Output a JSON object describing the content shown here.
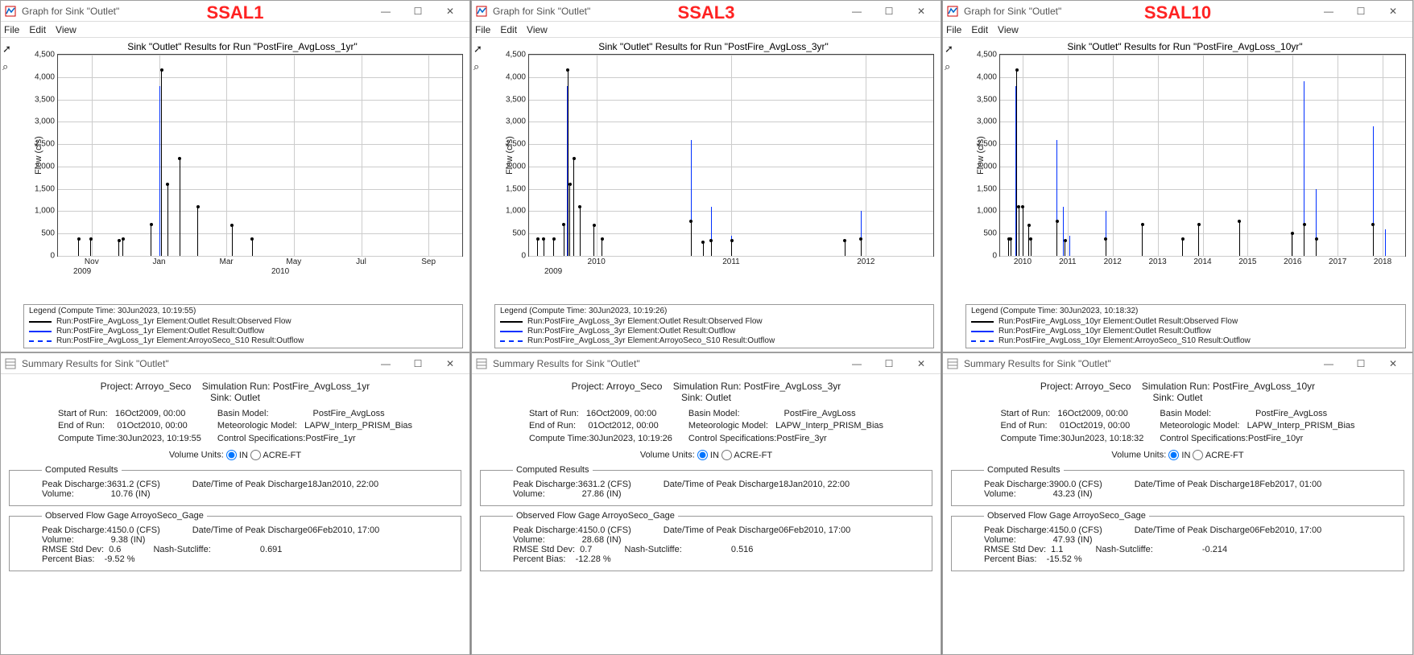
{
  "panels": [
    {
      "id": "ssal1",
      "overlay": "SSAL1",
      "graph_window_title": "Graph for Sink \"Outlet\"",
      "summary_window_title": "Summary Results for Sink \"Outlet\"",
      "menu": {
        "file": "File",
        "edit": "Edit",
        "view": "View"
      },
      "chart_title": "Sink \"Outlet\" Results for Run \"PostFire_AvgLoss_1yr\"",
      "legend_title": "Legend (Compute Time: 30Jun2023, 10:19:55)",
      "legend_items": [
        "Run:PostFire_AvgLoss_1yr Element:Outlet Result:Observed Flow",
        "Run:PostFire_AvgLoss_1yr Element:Outlet Result:Outflow",
        "Run:PostFire_AvgLoss_1yr Element:ArroyoSeco_S10 Result:Outflow"
      ],
      "summary": {
        "project": "Arroyo_Seco",
        "run": "PostFire_AvgLoss_1yr",
        "sink": "Outlet",
        "start": "16Oct2009, 00:00",
        "end": "01Oct2010, 00:00",
        "compute": "30Jun2023, 10:19:55",
        "basin": "PostFire_AvgLoss",
        "met": "LAPW_Interp_PRISM_Bias",
        "ctrl": "PostFire_1yr",
        "computed": {
          "peak_discharge": "3631.2 (CFS)",
          "peak_time": "18Jan2010, 22:00",
          "volume": "10.76 (IN)"
        },
        "observed": {
          "gage": "ArroyoSeco_Gage",
          "peak_discharge": "4150.0 (CFS)",
          "peak_time": "06Feb2010, 17:00",
          "volume": "9.38 (IN)",
          "rmse": "0.6",
          "nash": "0.691",
          "bias": "-9.52 %"
        }
      },
      "chart_data": {
        "type": "line",
        "title": "Sink \"Outlet\" Results for Run \"PostFire_AvgLoss_1yr\"",
        "ylabel": "Flow (cfs)",
        "ylim": [
          0,
          4500
        ],
        "y_ticks": [
          0,
          500,
          1000,
          1500,
          2000,
          2500,
          3000,
          3500,
          4000,
          4500
        ],
        "x_ticks": [
          "Nov",
          "Jan",
          "Mar",
          "May",
          "Jul",
          "Sep"
        ],
        "x_years": [
          "2009",
          "2010"
        ],
        "series": [
          {
            "name": "Observed Flow",
            "color": "#000",
            "peaks": [
              {
                "x": 0.05,
                "y": 380
              },
              {
                "x": 0.08,
                "y": 380
              },
              {
                "x": 0.15,
                "y": 350
              },
              {
                "x": 0.16,
                "y": 380
              },
              {
                "x": 0.23,
                "y": 700
              },
              {
                "x": 0.255,
                "y": 4150
              },
              {
                "x": 0.27,
                "y": 1600
              },
              {
                "x": 0.3,
                "y": 2180
              },
              {
                "x": 0.345,
                "y": 1100
              },
              {
                "x": 0.43,
                "y": 680
              },
              {
                "x": 0.48,
                "y": 380
              }
            ]
          },
          {
            "name": "Outflow",
            "color": "#0030ff",
            "peaks": [
              {
                "x": 0.05,
                "y": 60
              },
              {
                "x": 0.15,
                "y": 80
              },
              {
                "x": 0.23,
                "y": 350
              },
              {
                "x": 0.25,
                "y": 3800
              },
              {
                "x": 0.27,
                "y": 1400
              },
              {
                "x": 0.3,
                "y": 1850
              },
              {
                "x": 0.345,
                "y": 600
              },
              {
                "x": 0.43,
                "y": 280
              },
              {
                "x": 0.48,
                "y": 180
              }
            ]
          }
        ]
      }
    },
    {
      "id": "ssal3",
      "overlay": "SSAL3",
      "graph_window_title": "Graph for Sink \"Outlet\"",
      "summary_window_title": "Summary Results for Sink \"Outlet\"",
      "menu": {
        "file": "File",
        "edit": "Edit",
        "view": "View"
      },
      "chart_title": "Sink \"Outlet\" Results for Run \"PostFire_AvgLoss_3yr\"",
      "legend_title": "Legend (Compute Time: 30Jun2023, 10:19:26)",
      "legend_items": [
        "Run:PostFire_AvgLoss_3yr Element:Outlet Result:Observed Flow",
        "Run:PostFire_AvgLoss_3yr Element:Outlet Result:Outflow",
        "Run:PostFire_AvgLoss_3yr Element:ArroyoSeco_S10 Result:Outflow"
      ],
      "summary": {
        "project": "Arroyo_Seco",
        "run": "PostFire_AvgLoss_3yr",
        "sink": "Outlet",
        "start": "16Oct2009, 00:00",
        "end": "01Oct2012, 00:00",
        "compute": "30Jun2023, 10:19:26",
        "basin": "PostFire_AvgLoss",
        "met": "LAPW_Interp_PRISM_Bias",
        "ctrl": "PostFire_3yr",
        "computed": {
          "peak_discharge": "3631.2 (CFS)",
          "peak_time": "18Jan2010, 22:00",
          "volume": "27.86 (IN)"
        },
        "observed": {
          "gage": "ArroyoSeco_Gage",
          "peak_discharge": "4150.0 (CFS)",
          "peak_time": "06Feb2010, 17:00",
          "volume": "28.68 (IN)",
          "rmse": "0.7",
          "nash": "0.516",
          "bias": "-12.28 %"
        }
      },
      "chart_data": {
        "type": "line",
        "title": "Sink \"Outlet\" Results for Run \"PostFire_AvgLoss_3yr\"",
        "ylabel": "Flow (cfs)",
        "ylim": [
          0,
          4500
        ],
        "y_ticks": [
          0,
          500,
          1000,
          1500,
          2000,
          2500,
          3000,
          3500,
          4000,
          4500
        ],
        "x_ticks": [
          "2010",
          "2011",
          "2012"
        ],
        "x_years": [
          "2009"
        ],
        "series": [
          {
            "name": "Observed Flow",
            "color": "#000",
            "peaks": [
              {
                "x": 0.02,
                "y": 380
              },
              {
                "x": 0.035,
                "y": 380
              },
              {
                "x": 0.06,
                "y": 380
              },
              {
                "x": 0.085,
                "y": 700
              },
              {
                "x": 0.095,
                "y": 4150
              },
              {
                "x": 0.1,
                "y": 1600
              },
              {
                "x": 0.11,
                "y": 2180
              },
              {
                "x": 0.125,
                "y": 1100
              },
              {
                "x": 0.16,
                "y": 680
              },
              {
                "x": 0.18,
                "y": 380
              },
              {
                "x": 0.4,
                "y": 780
              },
              {
                "x": 0.43,
                "y": 300
              },
              {
                "x": 0.45,
                "y": 350
              },
              {
                "x": 0.5,
                "y": 350
              },
              {
                "x": 0.78,
                "y": 350
              },
              {
                "x": 0.82,
                "y": 380
              }
            ]
          },
          {
            "name": "Outflow",
            "color": "#0030ff",
            "peaks": [
              {
                "x": 0.085,
                "y": 350
              },
              {
                "x": 0.093,
                "y": 3800
              },
              {
                "x": 0.1,
                "y": 1400
              },
              {
                "x": 0.11,
                "y": 1850
              },
              {
                "x": 0.125,
                "y": 600
              },
              {
                "x": 0.16,
                "y": 280
              },
              {
                "x": 0.4,
                "y": 2600
              },
              {
                "x": 0.43,
                "y": 300
              },
              {
                "x": 0.45,
                "y": 1100
              },
              {
                "x": 0.5,
                "y": 450
              },
              {
                "x": 0.78,
                "y": 350
              },
              {
                "x": 0.82,
                "y": 1000
              }
            ]
          }
        ]
      }
    },
    {
      "id": "ssal10",
      "overlay": "SSAL10",
      "graph_window_title": "Graph for Sink \"Outlet\"",
      "summary_window_title": "Summary Results for Sink \"Outlet\"",
      "menu": {
        "file": "File",
        "edit": "Edit",
        "view": "View"
      },
      "chart_title": "Sink \"Outlet\" Results for Run \"PostFire_AvgLoss_10yr\"",
      "legend_title": "Legend (Compute Time: 30Jun2023, 10:18:32)",
      "legend_items": [
        "Run:PostFire_AvgLoss_10yr Element:Outlet Result:Observed Flow",
        "Run:PostFire_AvgLoss_10yr Element:Outlet Result:Outflow",
        "Run:PostFire_AvgLoss_10yr Element:ArroyoSeco_S10 Result:Outflow"
      ],
      "summary": {
        "project": "Arroyo_Seco",
        "run": "PostFire_AvgLoss_10yr",
        "sink": "Outlet",
        "start": "16Oct2009, 00:00",
        "end": "01Oct2019, 00:00",
        "compute": "30Jun2023, 10:18:32",
        "basin": "PostFire_AvgLoss",
        "met": "LAPW_Interp_PRISM_Bias",
        "ctrl": "PostFire_10yr",
        "computed": {
          "peak_discharge": "3900.0 (CFS)",
          "peak_time": "18Feb2017, 01:00",
          "volume": "43.23 (IN)"
        },
        "observed": {
          "gage": "ArroyoSeco_Gage",
          "peak_discharge": "4150.0 (CFS)",
          "peak_time": "06Feb2010, 17:00",
          "volume": "47.93 (IN)",
          "rmse": "1.1",
          "nash": "-0.214",
          "bias": "-15.52 %"
        }
      },
      "chart_data": {
        "type": "line",
        "title": "Sink \"Outlet\" Results for Run \"PostFire_AvgLoss_10yr\"",
        "ylabel": "Flow (cfs)",
        "ylim": [
          0,
          4500
        ],
        "y_ticks": [
          0,
          500,
          1000,
          1500,
          2000,
          2500,
          3000,
          3500,
          4000,
          4500
        ],
        "x_ticks": [
          "2010",
          "2011",
          "2012",
          "2013",
          "2014",
          "2015",
          "2016",
          "2017",
          "2018"
        ],
        "x_years": [],
        "series": [
          {
            "name": "Observed Flow",
            "color": "#000",
            "peaks": [
              {
                "x": 0.02,
                "y": 380
              },
              {
                "x": 0.025,
                "y": 380
              },
              {
                "x": 0.04,
                "y": 4150
              },
              {
                "x": 0.045,
                "y": 1100
              },
              {
                "x": 0.055,
                "y": 1100
              },
              {
                "x": 0.07,
                "y": 680
              },
              {
                "x": 0.075,
                "y": 380
              },
              {
                "x": 0.14,
                "y": 780
              },
              {
                "x": 0.16,
                "y": 350
              },
              {
                "x": 0.26,
                "y": 380
              },
              {
                "x": 0.35,
                "y": 700
              },
              {
                "x": 0.45,
                "y": 380
              },
              {
                "x": 0.49,
                "y": 700
              },
              {
                "x": 0.59,
                "y": 780
              },
              {
                "x": 0.72,
                "y": 500
              },
              {
                "x": 0.75,
                "y": 700
              },
              {
                "x": 0.78,
                "y": 380
              },
              {
                "x": 0.92,
                "y": 700
              }
            ]
          },
          {
            "name": "Outflow",
            "color": "#0030ff",
            "peaks": [
              {
                "x": 0.038,
                "y": 3800
              },
              {
                "x": 0.045,
                "y": 980
              },
              {
                "x": 0.055,
                "y": 600
              },
              {
                "x": 0.14,
                "y": 2600
              },
              {
                "x": 0.155,
                "y": 1100
              },
              {
                "x": 0.17,
                "y": 450
              },
              {
                "x": 0.26,
                "y": 1000
              },
              {
                "x": 0.35,
                "y": 280
              },
              {
                "x": 0.72,
                "y": 500
              },
              {
                "x": 0.75,
                "y": 3900
              },
              {
                "x": 0.78,
                "y": 1500
              },
              {
                "x": 0.92,
                "y": 2900
              },
              {
                "x": 0.95,
                "y": 600
              }
            ]
          }
        ]
      }
    }
  ],
  "labels": {
    "project": "Project:",
    "run": "Simulation Run:",
    "sink": "Sink:",
    "start": "Start of Run:",
    "end": "End of Run:",
    "compute": "Compute Time:",
    "basin": "Basin Model:",
    "met": "Meteorologic Model:",
    "ctrl": "Control Specifications:",
    "units": "Volume Units:",
    "in": "IN",
    "acreft": "ACRE-FT",
    "computed": "Computed Results",
    "observed_prefix": "Observed Flow Gage ",
    "peak": "Peak Discharge:",
    "peak_time": "Date/Time of Peak Discharge",
    "volume": "Volume:",
    "rmse": "RMSE Std Dev:",
    "nash": "Nash-Sutcliffe:",
    "bias": "Percent Bias:"
  }
}
